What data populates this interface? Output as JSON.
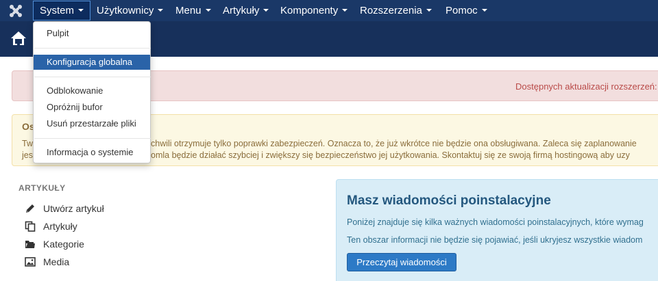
{
  "nav": {
    "logo_icon": "joomla-logo-icon",
    "items": [
      {
        "label": "System",
        "active": true
      },
      {
        "label": "Użytkownicy"
      },
      {
        "label": "Menu"
      },
      {
        "label": "Artykuły"
      },
      {
        "label": "Komponenty"
      },
      {
        "label": "Rozszerzenia"
      },
      {
        "label": "Pomoc"
      }
    ]
  },
  "system_menu": {
    "items": [
      {
        "label": "Pulpit"
      },
      {
        "label": "Konfiguracja globalna",
        "selected": true
      },
      {
        "label": "Odblokowanie"
      },
      {
        "label": "Opróżnij bufor"
      },
      {
        "label": "Usuń przestarzałe pliki"
      },
      {
        "label": "Informacja o systemie"
      }
    ]
  },
  "subhead": {
    "home_icon": "home-icon"
  },
  "alerts": {
    "update_notice": "Dostępnych aktualizacji rozszerzeń:",
    "warning_title": "Os",
    "warning_line1_left": "Tw",
    "warning_line1_right": "chwili otrzymuje tylko poprawki zabezpieczeń. Oznacza to, że już wkrótce nie będzie ona obsługiwana. Zaleca się zaplanowanie",
    "warning_line2_left": "jes",
    "warning_line2_right": "omla będzie działać szybciej i zwiększy się bezpieczeństwo jej użytkowania. Skontaktuj się ze swoją firmą hostingową aby uzy"
  },
  "sidebar": {
    "heading": "ARTYKUŁY",
    "items": [
      {
        "label": "Utwórz artykuł",
        "icon": "pencil-icon"
      },
      {
        "label": "Artykuły",
        "icon": "copy-icon"
      },
      {
        "label": "Kategorie",
        "icon": "folder-icon"
      },
      {
        "label": "Media",
        "icon": "image-icon"
      }
    ]
  },
  "postinstall": {
    "title": "Masz wiadomości poinstalacyjne",
    "text1": "Poniżej znajduje się kilka ważnych wiadomości poinstalacyjnych, które wymag",
    "text2": "Ten obszar informacji nie będzie się pojawiać, jeśli ukryjesz wszystkie wiadom",
    "button": "Przeczytaj wiadomości"
  },
  "colors": {
    "navbar": "#1a3867",
    "subhead": "#17305b",
    "menu_selected": "#2a63a8",
    "button": "#2d7ac6"
  }
}
